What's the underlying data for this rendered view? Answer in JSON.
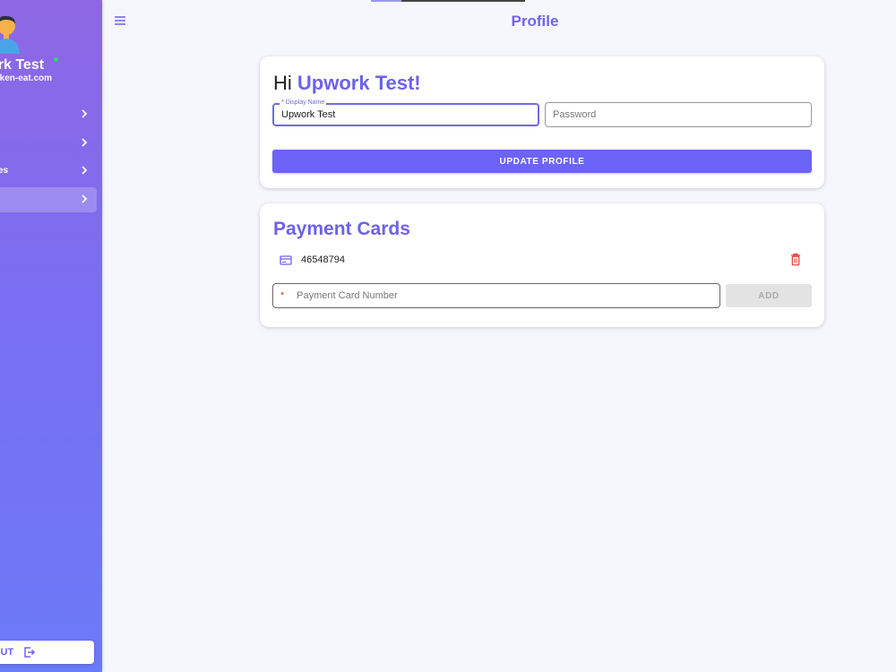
{
  "header": {
    "title": "Profile"
  },
  "sidebar": {
    "user_name": "ork Test",
    "user_domain": "baken-eat.com",
    "items": [
      {
        "label": ""
      },
      {
        "label": ""
      },
      {
        "label": "es"
      },
      {
        "label": "",
        "active": true
      }
    ],
    "logout_label": "OUT"
  },
  "profile": {
    "greeting_prefix": "Hi ",
    "greeting_name": "Upwork Test!",
    "display_name_label": "Display Name",
    "display_name_required": "*",
    "display_name_value": "Upwork Test",
    "password_placeholder": "Password",
    "update_button": "UPDATE PROFILE"
  },
  "payment": {
    "title": "Payment Cards",
    "cards": [
      {
        "number": "46548794"
      }
    ],
    "card_number_required": "*",
    "card_number_placeholder": "   Payment Card Number",
    "add_button": "ADD"
  },
  "colors": {
    "accent": "#6d62ea",
    "button": "#6c63f7",
    "danger": "#e53935",
    "online": "#38d36c"
  }
}
